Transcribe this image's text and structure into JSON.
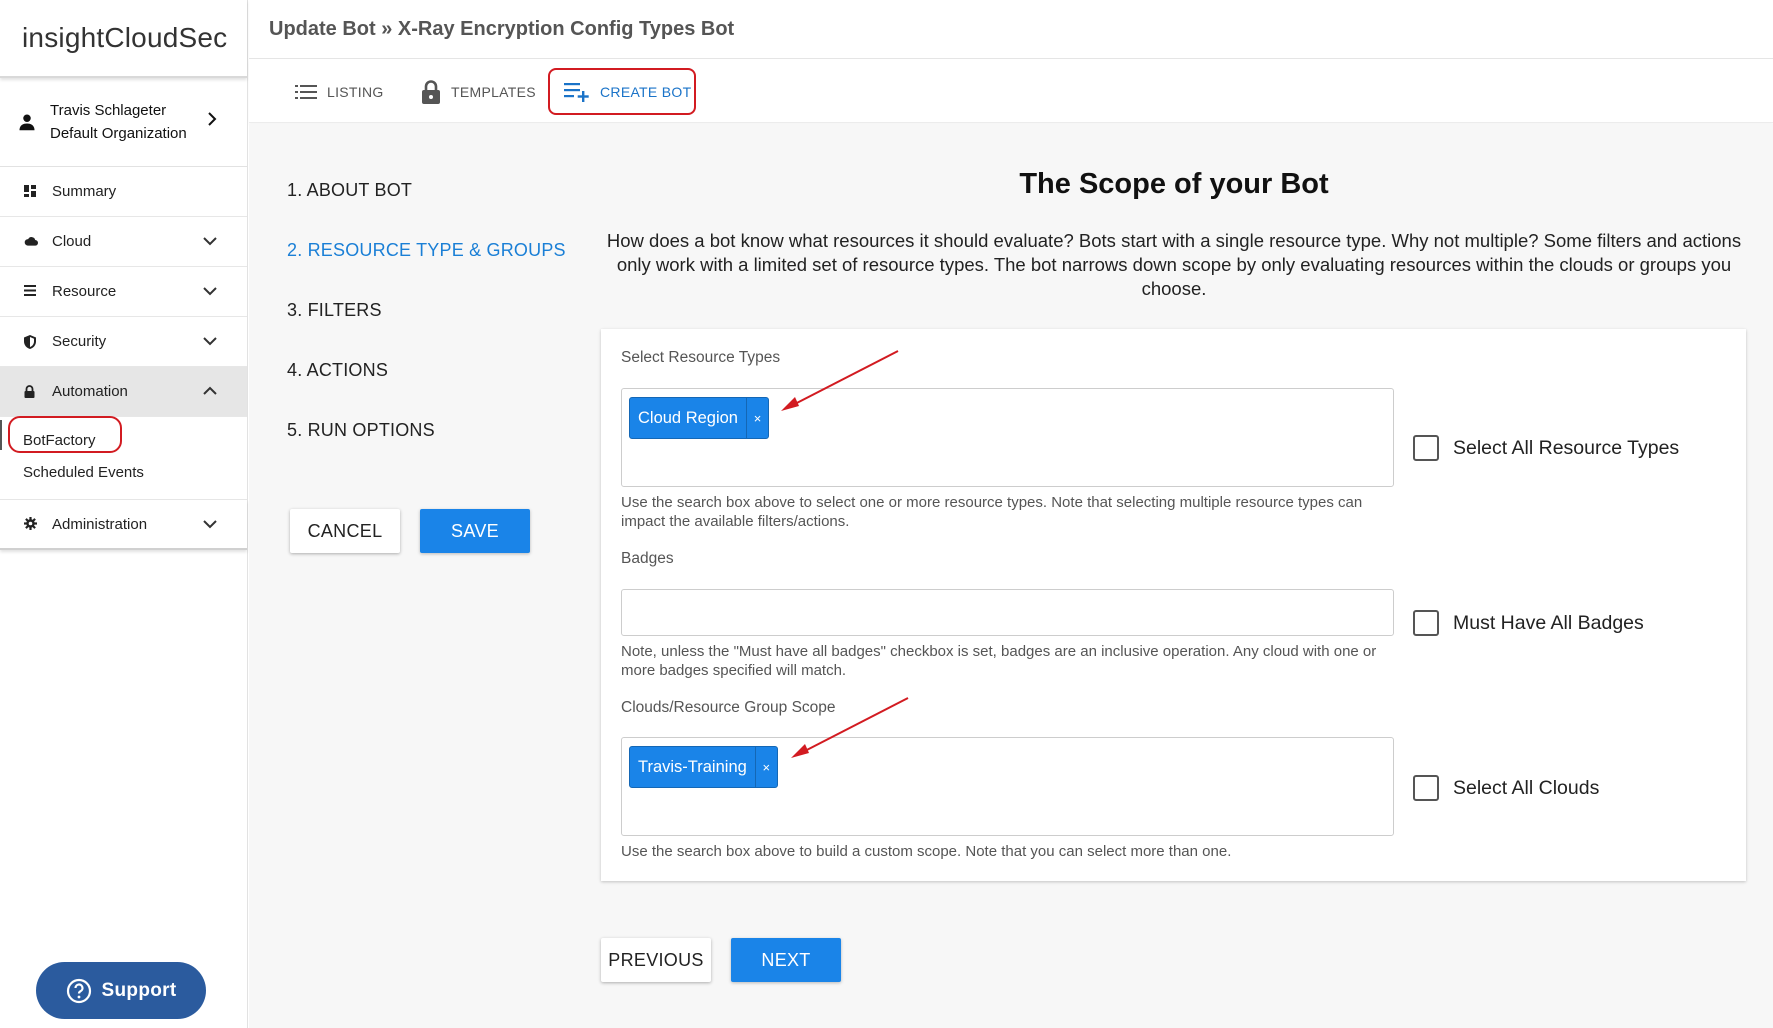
{
  "app": {
    "logo_light": "insight",
    "logo_bold": "CloudSec"
  },
  "user": {
    "name": "Travis Schlageter",
    "org": "Default Organization"
  },
  "nav": {
    "summary": "Summary",
    "cloud": "Cloud",
    "resource": "Resource",
    "security": "Security",
    "automation": "Automation",
    "botfactory": "BotFactory",
    "scheduled_events": "Scheduled Events",
    "administration": "Administration"
  },
  "support_label": "Support",
  "header": {
    "breadcrumb": "Update Bot » X-Ray Encryption Config Types Bot"
  },
  "tabs": {
    "listing": "LISTING",
    "templates": "TEMPLATES",
    "create_bot": "CREATE BOT"
  },
  "steps": [
    "1. ABOUT BOT",
    "2. RESOURCE TYPE & GROUPS",
    "3. FILTERS",
    "4. ACTIONS",
    "5. RUN OPTIONS"
  ],
  "buttons": {
    "cancel": "CANCEL",
    "save": "SAVE",
    "previous": "PREVIOUS",
    "next": "NEXT"
  },
  "scope": {
    "title": "The Scope of your Bot",
    "description": "How does a bot know what resources it should evaluate? Bots start with a single resource type. Why not multiple? Some filters and actions only work with a limited set of resource types. The bot narrows down scope by only evaluating resources within the clouds or groups you choose."
  },
  "form": {
    "resource_types_label": "Select Resource Types",
    "resource_types_chip": "Cloud Region",
    "resource_types_hint": "Use the search box above to select one or more resource types. Note that selecting multiple resource types can impact the available filters/actions.",
    "select_all_resource_types": "Select All Resource Types",
    "badges_label": "Badges",
    "badges_hint": "Note, unless the \"Must have all badges\" checkbox is set, badges are an inclusive operation. Any cloud with one or more badges specified will match.",
    "must_have_all_badges": "Must Have All Badges",
    "scope_label": "Clouds/Resource Group Scope",
    "scope_chip": "Travis-Training",
    "scope_hint": "Use the search box above to build a custom scope. Note that you can select more than one.",
    "select_all_clouds": "Select All Clouds",
    "chip_remove": "×"
  },
  "colors": {
    "accent": "#1a84e8",
    "annotation": "#d21b21",
    "support": "#2b5b9e"
  }
}
